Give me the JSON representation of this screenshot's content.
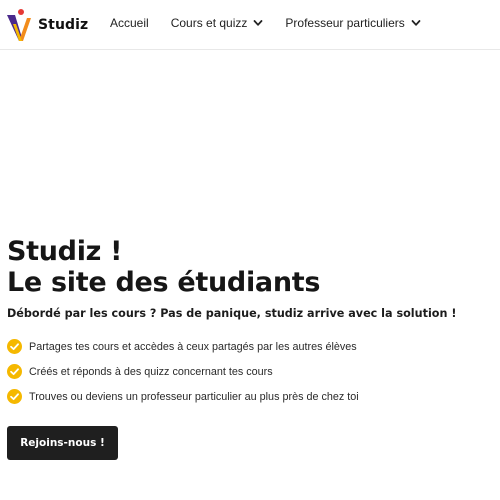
{
  "header": {
    "brand": "Studiz",
    "nav": [
      {
        "label": "Accueil"
      },
      {
        "label": "Cours et quizz"
      },
      {
        "label": "Professeur particuliers"
      }
    ]
  },
  "hero": {
    "title_line1": "Studiz !",
    "title_line2": "Le site des étudiants",
    "subtitle": "Débordé par les cours ? Pas de panique, studiz arrive avec la solution !",
    "features": [
      "Partages tes cours et accèdes à ceux partagés par les autres élèves",
      "Créés et réponds à des quizz concernant tes cours",
      "Trouves ou deviens un professeur particulier au plus près de chez toi"
    ],
    "cta": "Rejoins-nous !"
  },
  "colors": {
    "accent": "#f5b800",
    "dark": "#1f1f1f",
    "logo_purple": "#4b2a8c",
    "logo_orange": "#f28c1b"
  },
  "icons": {
    "logo": "studiz-logo",
    "dropdown": "chevron-down-icon",
    "feature": "check-circle-icon"
  }
}
